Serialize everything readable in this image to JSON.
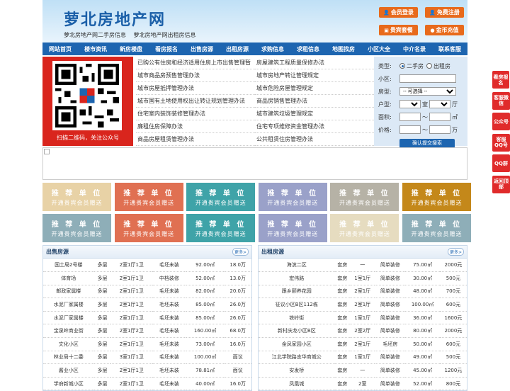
{
  "header": {
    "logo": "萝北房地产网",
    "slogans": [
      "萝北房地产网二手房信息",
      "萝北房地产网出租房信息"
    ],
    "buttons": [
      "会员登录",
      "免费注册",
      "贵宾套餐",
      "金币充值"
    ],
    "brand_color": "#1d65b0",
    "accent_color": "#e86a1c"
  },
  "nav": [
    "网站首页",
    "楼市资讯",
    "新房楼盘",
    "看房报名",
    "出售房源",
    "出租房源",
    "求购信息",
    "求租信息",
    "地图找房",
    "小区大全",
    "中介名录",
    "联系客服"
  ],
  "qr": {
    "caption": "扫描二维码，关注公众号"
  },
  "links": [
    "已购公有住房和经济适用住房上市出售管理暂",
    "房屋建筑工程质量保修办法",
    "城市商品房预售管理办法",
    "城市房地产转让管理规定",
    "城市房屋抵押管理办法",
    "城市危险房屋管理规定",
    "城市国有土地使用权出让转让规划管理办法",
    "商品房销售管理办法",
    "住宅室内装饰装修管理办法",
    "城市建筑垃圾管理规定",
    "廉租住房保障办法",
    "住宅专项维修资金管理办法",
    "商品房屋租赁管理办法",
    "公共租赁住房管理办法"
  ],
  "search": {
    "type_label": "类型:",
    "opt_sale": "二手房",
    "opt_rent": "出租房",
    "community_label": "小区:",
    "house_type_label": "房型:",
    "house_type_value": "-- 可选择 --",
    "layout_label": "户型:",
    "room_unit": "室",
    "hall_unit": "厅",
    "area_label": "面积:",
    "area_sep": "～",
    "area_unit": "㎡",
    "price_label": "价格:",
    "price_sep": "～",
    "price_unit": "万",
    "submit": "确认提交搜索"
  },
  "recommend": {
    "title": "推 荐 单 位",
    "sub": "开通贵宾会员赠送",
    "colors": [
      "#e8d2a6",
      "#e07052",
      "#3fa3a8",
      "#9aa1c9",
      "#b6b2a6",
      "#c4881a",
      "#8eaeb8",
      "#e07052",
      "#3fa3a8",
      "#9aa1c9",
      "#e6dcc0",
      "#8eaeb8"
    ]
  },
  "sale": {
    "title": "出售房源",
    "more": "更多>",
    "rows": [
      [
        "国土局2号楼",
        "多层",
        "2室1厅1卫",
        "毛坯未装",
        "92.00㎡",
        "18.0万"
      ],
      [
        "体育场",
        "多层",
        "2室1厅1卫",
        "中档装修",
        "52.00㎡",
        "13.0万"
      ],
      [
        "邮政家属楼",
        "多层",
        "2室1厅1卫",
        "毛坯未装",
        "82.00㎡",
        "20.0万"
      ],
      [
        "水泥厂家属楼",
        "多层",
        "2室1厅1卫",
        "毛坯未装",
        "85.00㎡",
        "26.0万"
      ],
      [
        "水泥厂家属楼",
        "多层",
        "2室1厅1卫",
        "毛坯未装",
        "85.00㎡",
        "26.0万"
      ],
      [
        "宝泉岭商业街",
        "多层",
        "2室1厅2卫",
        "毛坯未装",
        "160.00㎡",
        "68.0万"
      ],
      [
        "文化小区",
        "多层",
        "2室1厅1卫",
        "毛坯未装",
        "73.00㎡",
        "16.0万"
      ],
      [
        "林业局十二委",
        "多层",
        "3室1厅1卫",
        "毛坯未装",
        "100.00㎡",
        "面议"
      ],
      [
        "酱业小区",
        "多层",
        "2室1厅1卫",
        "毛坯未装",
        "78.81㎡",
        "面议"
      ],
      [
        "学府新城小区",
        "多层",
        "2室1厅1卫",
        "毛坯未装",
        "40.00㎡",
        "16.0万"
      ]
    ]
  },
  "rent": {
    "title": "出租房源",
    "more": "更多>",
    "rows": [
      [
        "海滨二区",
        "套房",
        "一",
        "简单装修",
        "75.00㎡",
        "2000元"
      ],
      [
        "宏伟路",
        "套房",
        "1室1厅",
        "简单装修",
        "30.00㎡",
        "500元"
      ],
      [
        "跟乡颐养花园",
        "套房",
        "2室1厅",
        "简单装修",
        "48.00㎡",
        "700元"
      ],
      [
        "征议小区B区112栋",
        "套房",
        "2室1厅",
        "简单装修",
        "100.00㎡",
        "600元"
      ],
      [
        "铁岭街",
        "套房",
        "1室1厅",
        "简单装修",
        "36.00㎡",
        "1600元"
      ],
      [
        "新村庆龙小区B区",
        "套房",
        "2室2厅",
        "简单装修",
        "80.00㎡",
        "2000元"
      ],
      [
        "金凤家园小区",
        "套房",
        "2室1厅",
        "毛坯房",
        "50.00㎡",
        "600元"
      ],
      [
        "江北学院路志华商城公",
        "套房",
        "1室1厅",
        "简单装修",
        "49.00㎡",
        "500元"
      ],
      [
        "安发桥",
        "套房",
        "一",
        "简单装修",
        "45.00㎡",
        "1200元"
      ],
      [
        "凤凰城",
        "套房",
        "2室",
        "简单装修",
        "52.00㎡",
        "800元"
      ]
    ]
  },
  "float": [
    "看房报名",
    "客服微信",
    "公众号",
    "客服QQ号",
    "QQ群",
    "返回顶部"
  ]
}
